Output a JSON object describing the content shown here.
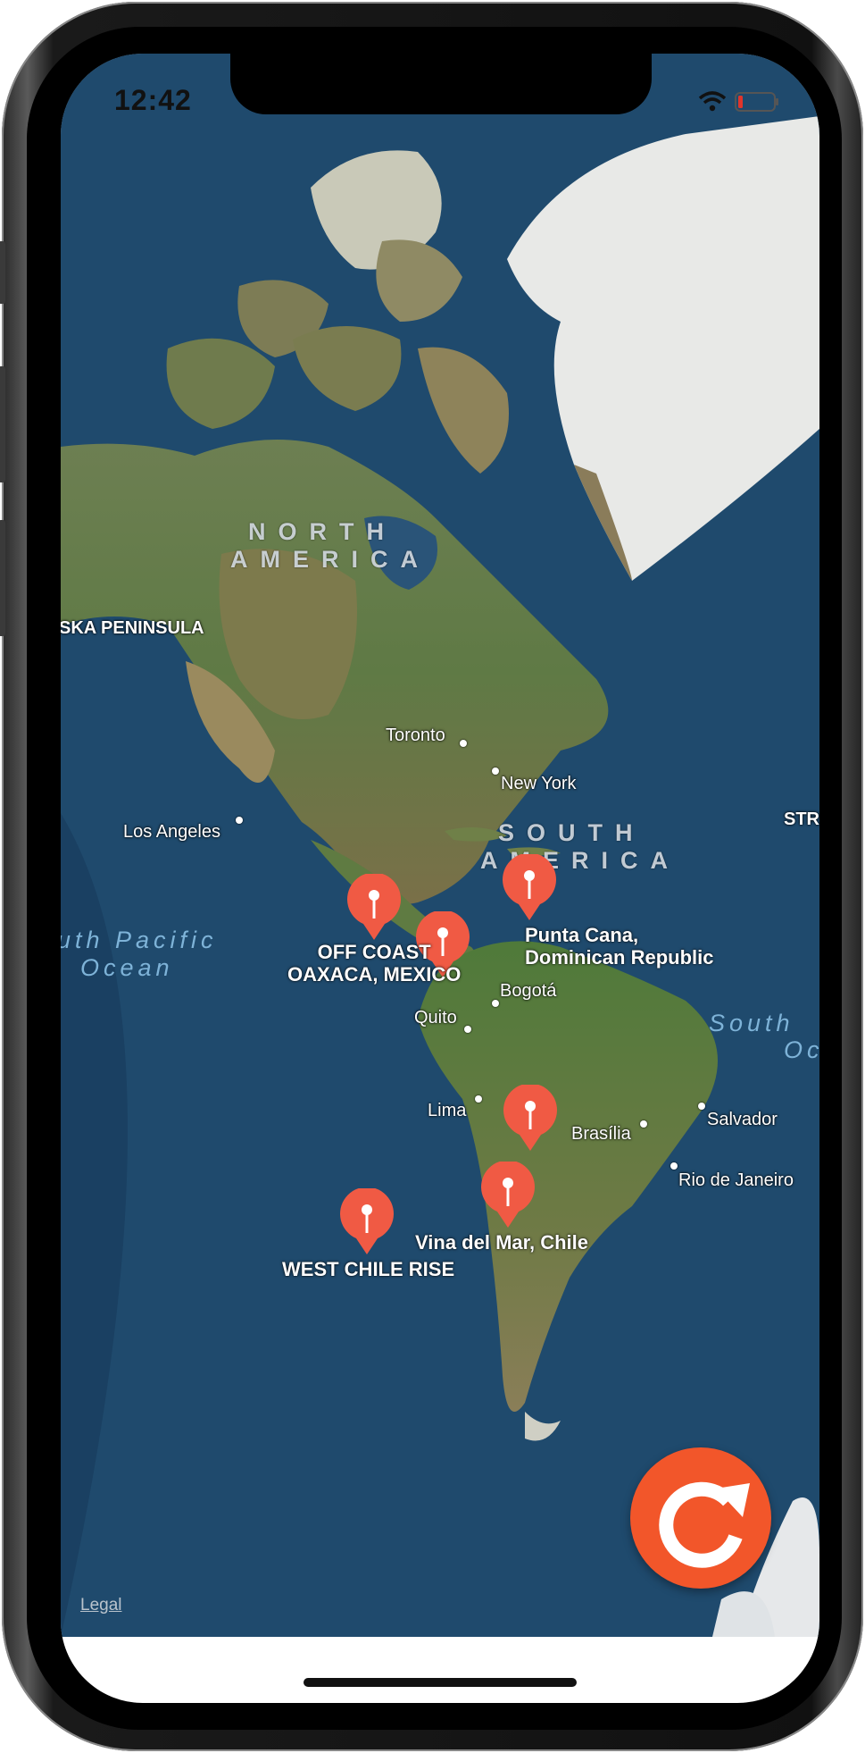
{
  "status_bar": {
    "time": "12:42"
  },
  "map": {
    "regions": {
      "north_america": [
        "NORTH",
        "AMERICA"
      ],
      "south_america": [
        "SOUTH",
        "AMERICA"
      ]
    },
    "oceans": {
      "south_pacific": [
        "uth Pacific",
        "Ocean"
      ],
      "south_atlantic": [
        "South",
        "Oc"
      ]
    },
    "places": {
      "alaska_peninsula": "SKA PENINSULA",
      "strait": "STR",
      "toronto": "Toronto",
      "new_york": "New York",
      "los_angeles": "Los Angeles",
      "bogota": "Bogotá",
      "quito": "Quito",
      "lima": "Lima",
      "brasilia": "Brasília",
      "salvador": "Salvador",
      "rio": "Rio de Janeiro"
    },
    "pins": [
      {
        "label": "OFF COAST OF OAXACA, MEXICO",
        "line1": "OFF COAST",
        "line2": "OAXACA, MEXICO"
      },
      {
        "label": "Punta Cana, Dominican Republic",
        "line1": "Punta Cana,",
        "line2": "Dominican Republic"
      },
      {
        "label": "Vina del Mar, Chile",
        "line1": "Vina del Mar, Chile"
      },
      {
        "label": "WEST CHILE RISE",
        "line1": "WEST CHILE RISE"
      }
    ],
    "legal_label": "Legal"
  },
  "colors": {
    "pin": "#f05a44",
    "refresh_button": "#f2562a"
  },
  "refresh_button": {
    "icon": "refresh-icon"
  }
}
